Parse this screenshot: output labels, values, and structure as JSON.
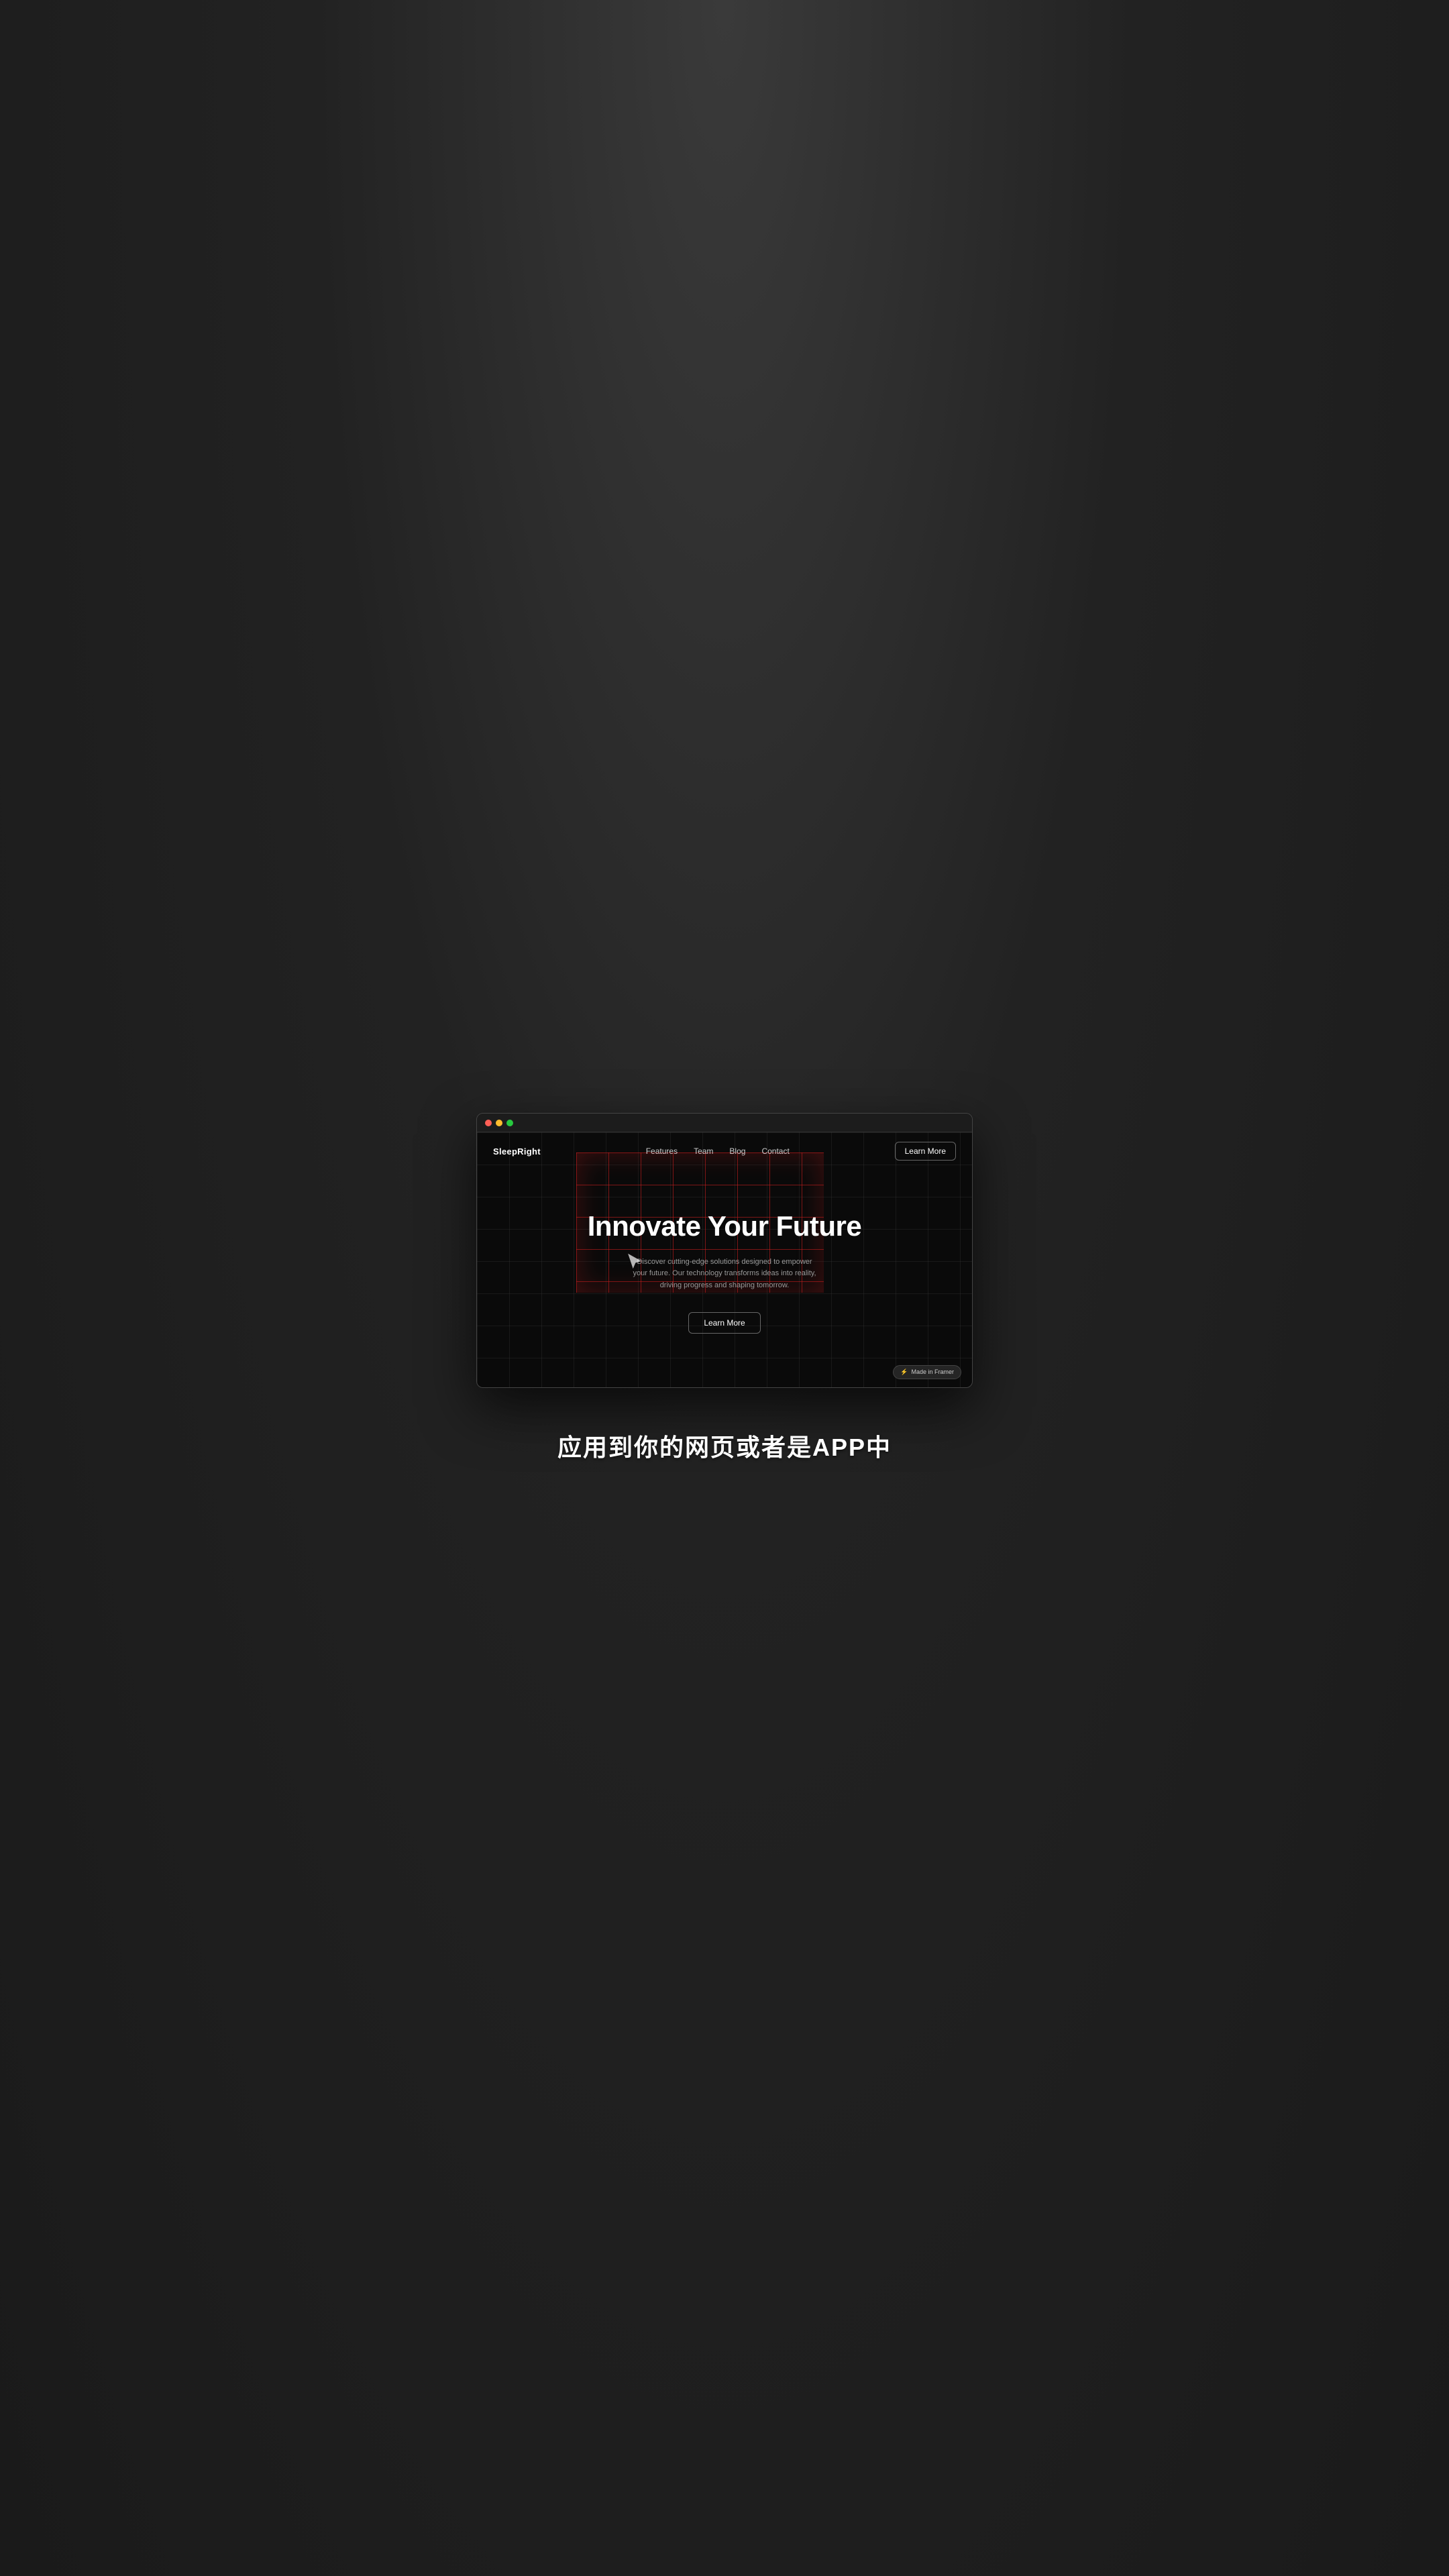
{
  "background": {
    "color": "#2a2a2a"
  },
  "browser": {
    "dots": [
      "red",
      "yellow",
      "green"
    ]
  },
  "navbar": {
    "logo": "SleepRight",
    "links": [
      {
        "label": "Features",
        "href": "#"
      },
      {
        "label": "Team",
        "href": "#"
      },
      {
        "label": "Blog",
        "href": "#"
      },
      {
        "label": "Contact",
        "href": "#"
      }
    ],
    "cta_label": "Learn More"
  },
  "hero": {
    "title": "Innovate Your Future",
    "subtitle": "Discover cutting-edge solutions designed to empower your future. Our technology transforms ideas into reality, driving progress and shaping tomorrow.",
    "cta_label": "Learn More"
  },
  "framer_badge": {
    "icon": "⚡",
    "text": "Made in Framer"
  },
  "bottom_text": "应用到你的网页或者是APP中"
}
